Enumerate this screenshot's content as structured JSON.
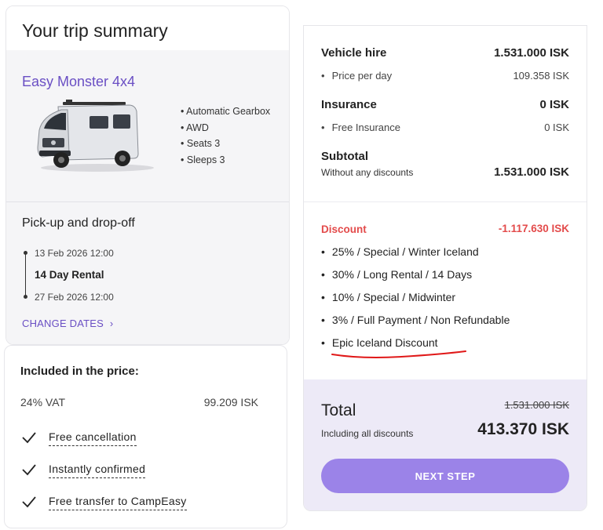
{
  "summary": {
    "title": "Your trip summary",
    "vehicle_name": "Easy Monster 4x4",
    "features": [
      "Automatic Gearbox",
      "AWD",
      "Seats 3",
      "Sleeps 3"
    ],
    "pickup_title": "Pick-up and drop-off",
    "pickup_datetime": "13 Feb 2026 12:00",
    "rental_length": "14 Day Rental",
    "dropoff_datetime": "27 Feb 2026 12:00",
    "change_dates_label": "CHANGE DATES"
  },
  "included": {
    "title": "Included in the price:",
    "vat_label": "24% VAT",
    "vat_value": "99.209 ISK",
    "perks": [
      "Free cancellation",
      "Instantly confirmed",
      "Free transfer to CampEasy"
    ]
  },
  "pricing": {
    "vehicle_hire_label": "Vehicle hire",
    "vehicle_hire_value": "1.531.000 ISK",
    "price_per_day_label": "Price per day",
    "price_per_day_value": "109.358 ISK",
    "insurance_label": "Insurance",
    "insurance_value": "0 ISK",
    "free_insurance_label": "Free Insurance",
    "free_insurance_value": "0 ISK",
    "subtotal_label": "Subtotal",
    "subtotal_sub": "Without any discounts",
    "subtotal_value": "1.531.000 ISK",
    "discount_label": "Discount",
    "discount_value": "-1.117.630 ISK",
    "discounts": [
      "25% / Special / Winter Iceland",
      "30% / Long Rental / 14 Days",
      "10% / Special / Midwinter",
      "3% / Full Payment / Non Refundable",
      "Epic Iceland Discount"
    ],
    "total_label": "Total",
    "total_sub": "Including all discounts",
    "original_total": "1.531.000 ISK",
    "total_value": "413.370 ISK",
    "next_step_label": "NEXT STEP"
  },
  "colors": {
    "accent_purple": "#6a4fc4",
    "button_purple": "#9b83e8",
    "discount_red": "#e34b4b",
    "total_bg": "#edeaf7",
    "annotation_red": "#e01818"
  }
}
